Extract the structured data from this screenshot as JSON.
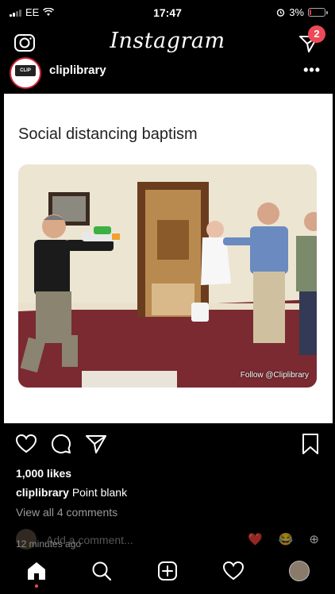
{
  "status_bar": {
    "carrier": "EE",
    "time": "17:47",
    "battery_percent": "3%",
    "battery_level": 0.03
  },
  "header": {
    "logo": "Instagram",
    "dm_badge_count": "2",
    "icons": {
      "left": "camera-icon",
      "right": "direct-message-icon"
    }
  },
  "post": {
    "username": "cliplibrary",
    "avatar_text": "CLIP LIBRARY",
    "more_label": "•••",
    "caption_title": "Social distancing baptism",
    "watermark": "Follow @Cliplibrary",
    "likes": "1,000 likes",
    "caption_user": "cliplibrary",
    "caption_text": "Point blank",
    "view_comments": "View all 4 comments",
    "add_comment_placeholder": "Add a comment...",
    "timestamp": "12 minutes ago",
    "quick_reactions": [
      "❤️",
      "😂",
      "⊕"
    ]
  },
  "tab_bar": {
    "items": [
      "home-icon",
      "search-icon",
      "add-post-icon",
      "activity-heart-icon",
      "profile-avatar"
    ]
  },
  "colors": {
    "background": "#000000",
    "badge": "#ed4956",
    "card": "#ffffff"
  }
}
